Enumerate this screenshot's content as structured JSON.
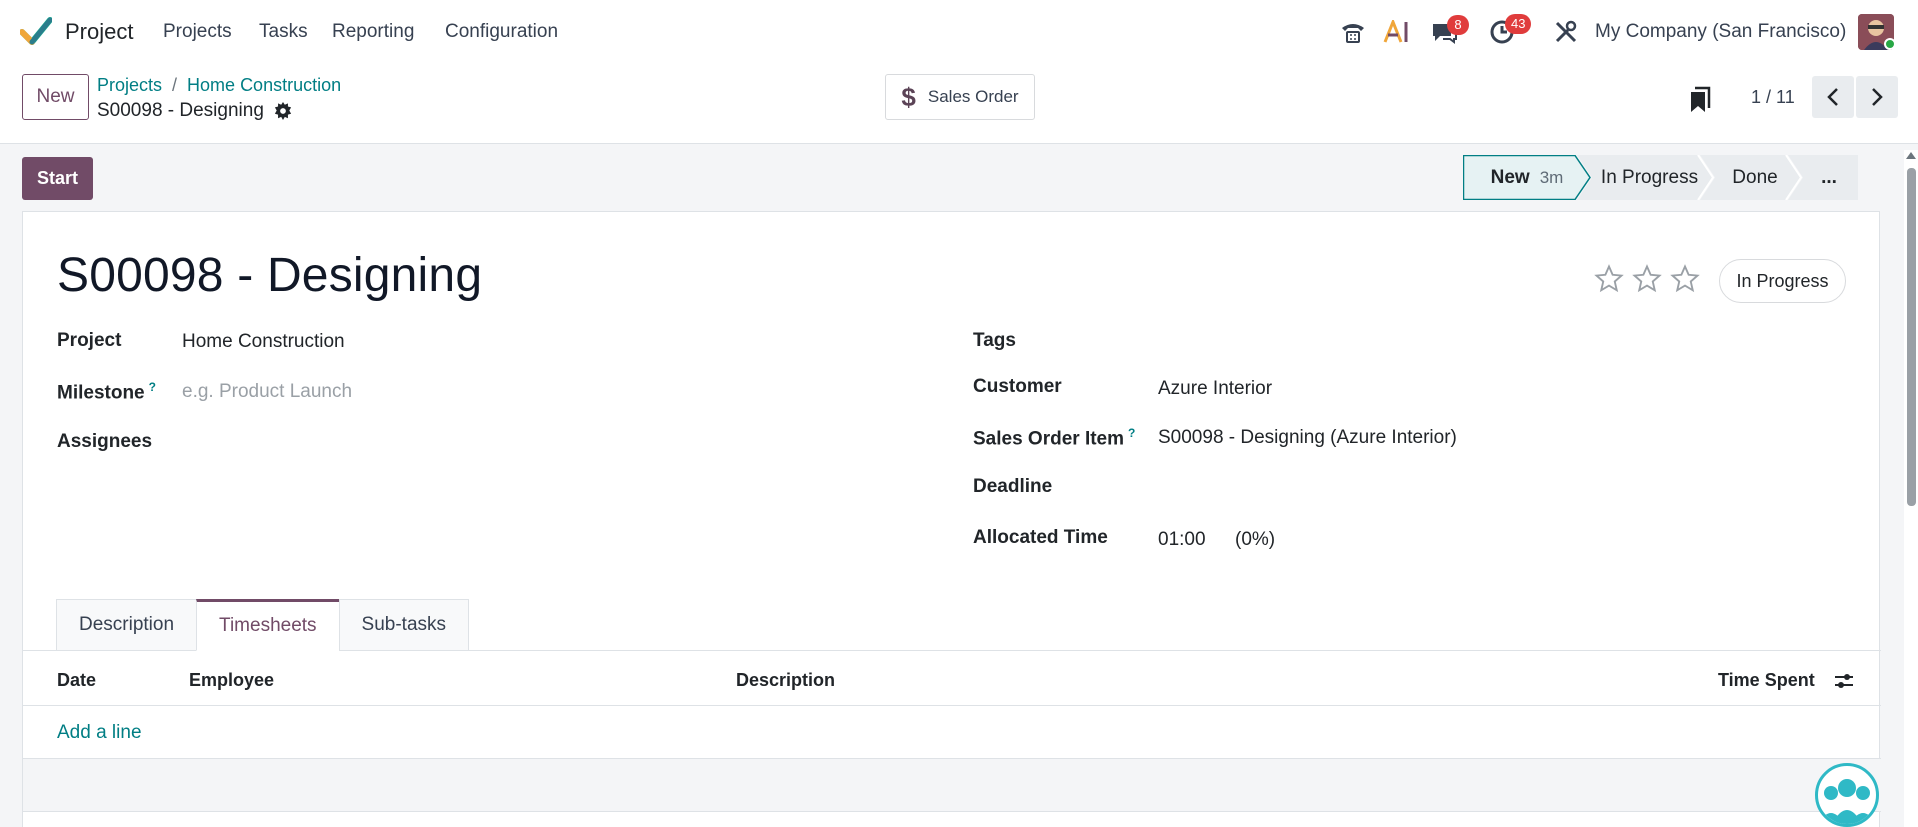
{
  "navbar": {
    "app_name": "Project",
    "menus": [
      "Projects",
      "Tasks",
      "Reporting",
      "Configuration"
    ],
    "messages_count": "8",
    "activities_count": "43",
    "company": "My Company (San Francisco)",
    "icons": [
      "phone-icon",
      "ai-icon",
      "chat-icon",
      "clock-icon",
      "tools-icon"
    ]
  },
  "control": {
    "new_label": "New",
    "breadcrumb": [
      "Projects",
      "Home Construction"
    ],
    "breadcrumb_sep": "/",
    "record_title": "S00098 - Designing",
    "smart_button": "Sales Order",
    "pager": "1 / 11"
  },
  "statusbar": {
    "start_label": "Start",
    "stages": [
      {
        "label": "New",
        "duration": "3m",
        "active": true
      },
      {
        "label": "In Progress",
        "active": false
      },
      {
        "label": "Done",
        "active": false
      },
      {
        "label": "...",
        "active": false
      }
    ]
  },
  "form": {
    "task_name": "S00098 - Designing",
    "state": "In Progress",
    "priority_stars": 0,
    "left_fields": {
      "project_label": "Project",
      "project_value": "Home Construction",
      "milestone_label": "Milestone",
      "milestone_help": "?",
      "milestone_placeholder": "e.g. Product Launch",
      "assignees_label": "Assignees"
    },
    "right_fields": {
      "tags_label": "Tags",
      "customer_label": "Customer",
      "customer_value": "Azure Interior",
      "sale_line_label": "Sales Order Item",
      "sale_line_help": "?",
      "sale_line_value": "S00098 - Designing (Azure Interior)",
      "deadline_label": "Deadline",
      "allocated_label": "Allocated Time",
      "allocated_value": "01:00",
      "allocated_percent": "(0%)"
    },
    "tabs": [
      {
        "label": "Description",
        "active": false
      },
      {
        "label": "Timesheets",
        "active": true
      },
      {
        "label": "Sub-tasks",
        "active": false
      }
    ],
    "timesheet_columns": [
      "Date",
      "Employee",
      "Description",
      "Time Spent"
    ],
    "add_line": "Add a line"
  },
  "colors": {
    "brand": "#714b67",
    "link": "#017e84",
    "badge": "#e03c3c"
  }
}
